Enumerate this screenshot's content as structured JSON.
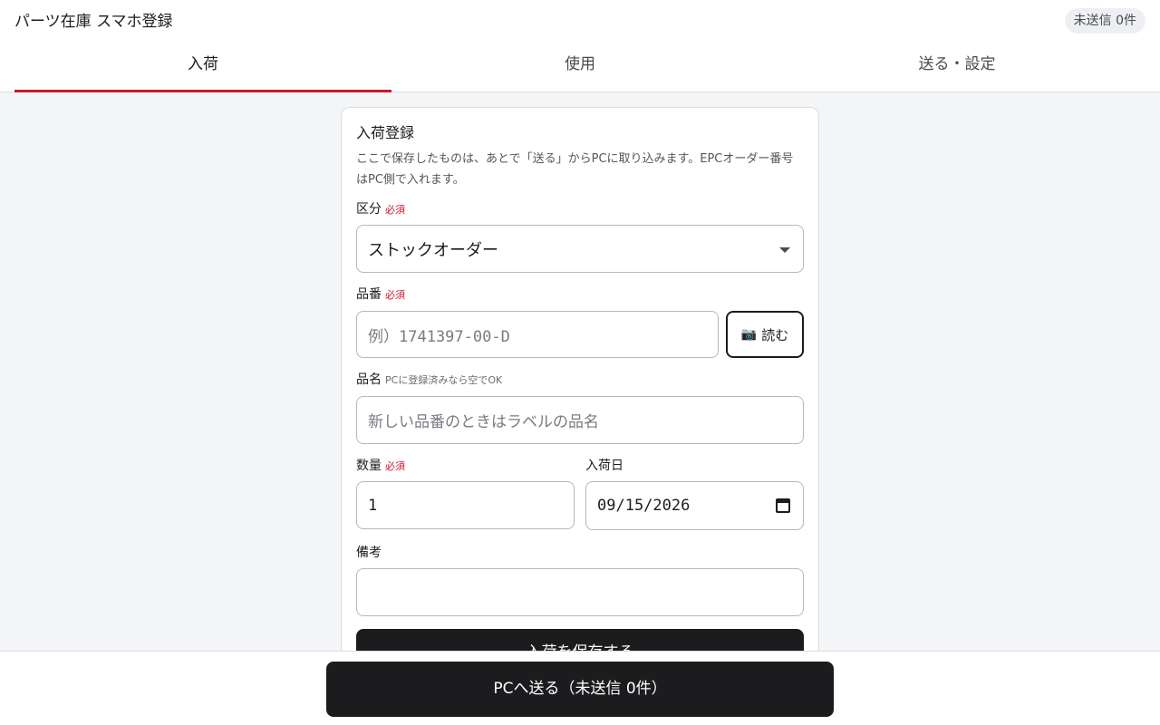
{
  "header": {
    "title": "パーツ在庫 スマホ登録",
    "unsent_badge": "未送信 0件"
  },
  "tabs": [
    {
      "label": "入荷",
      "active": true
    },
    {
      "label": "使用",
      "active": false
    },
    {
      "label": "送る・設定",
      "active": false
    }
  ],
  "form": {
    "title": "入荷登録",
    "description": "ここで保存したものは、あとで「送る」からPCに取り込みます。EPCオーダー番号はPC側で入れます。",
    "required_mark": "必須",
    "category": {
      "label": "区分",
      "value": "ストックオーダー"
    },
    "part_number": {
      "label": "品番",
      "placeholder": "例）1741397-00-D",
      "scan_label": "読む",
      "scan_icon": "camera-icon"
    },
    "part_name": {
      "label": "品名",
      "hint": "PCに登録済みなら空でOK",
      "placeholder": "新しい品番のときはラベルの品名"
    },
    "quantity": {
      "label": "数量",
      "value": "1"
    },
    "arrival_date": {
      "label": "入荷日",
      "value": "09/15/2026"
    },
    "notes": {
      "label": "備考",
      "value": ""
    },
    "save_label": "入荷を保存する"
  },
  "footer": {
    "send_label": "PCへ送る（未送信 0件）"
  },
  "colors": {
    "accent": "#c8182b",
    "primary_button": "#1c1c1f",
    "background": "#f4f5f7"
  }
}
